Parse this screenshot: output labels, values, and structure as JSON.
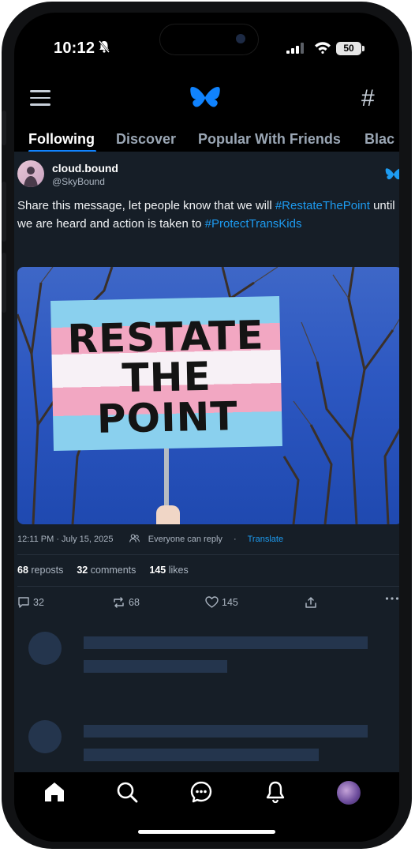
{
  "status_bar": {
    "time": "10:12",
    "battery": "50"
  },
  "tabs": [
    "Following",
    "Discover",
    "Popular With Friends",
    "Blac"
  ],
  "post": {
    "display_name": "cloud.bound",
    "handle": "@SkyBound",
    "text_part1": "Share this message, let people know that we will ",
    "hashtag1": "#RestateThePoint",
    "text_part2": " until we are heard and action is taken to ",
    "hashtag2": "#ProtectTransKids",
    "image_sign": {
      "line1": "RESTATE",
      "line2": "THE",
      "line3": "POINT"
    },
    "timestamp": "12:11 PM · July 15, 2025",
    "reply_setting": "Everyone can reply",
    "separator": "·",
    "translate_label": "Translate",
    "stats": {
      "reposts_count": "68",
      "reposts_label": "reposts",
      "comments_count": "32",
      "comments_label": "comments",
      "likes_count": "145",
      "likes_label": "likes"
    },
    "actions": {
      "reply_count": "32",
      "repost_count": "68",
      "like_count": "145"
    }
  },
  "colors": {
    "accent": "#1083fe",
    "link": "#1d9bf0",
    "feed_bg": "#161e27",
    "skeleton": "#24354d"
  },
  "icons": [
    "menu-icon",
    "butterfly-logo-icon",
    "hashtag-icon",
    "bluesky-badge-icon",
    "reply-icon",
    "repost-icon",
    "heart-icon",
    "share-icon",
    "more-icon",
    "home-icon",
    "search-icon",
    "chat-icon",
    "bell-icon",
    "profile-avatar"
  ]
}
